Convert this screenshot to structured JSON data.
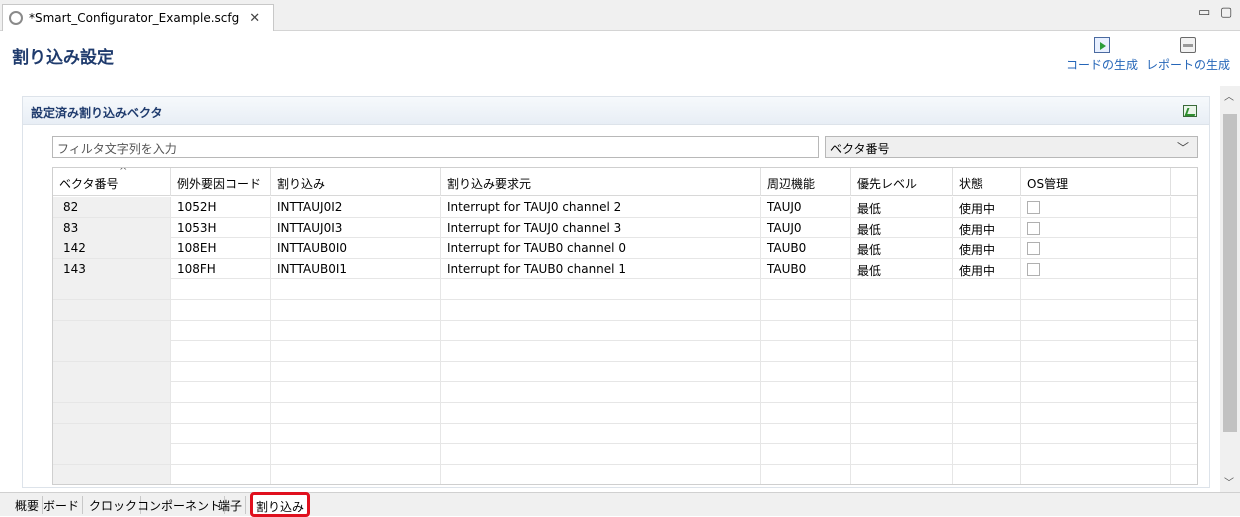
{
  "editor_tab": {
    "title": "*Smart_Configurator_Example.scfg",
    "close": "✕"
  },
  "window_controls": {
    "minimize": "▭",
    "maximize": "▢"
  },
  "header": {
    "title": "割り込み設定",
    "actions": {
      "generate_code": "コードの生成",
      "generate_report": "レポートの生成"
    }
  },
  "section": {
    "title": "設定済み割り込みベクタ",
    "filter_placeholder": "フィルタ文字列を入力",
    "combo_value": "ベクタ番号"
  },
  "table": {
    "columns": [
      "ベクタ番号",
      "例外要因コード",
      "割り込み",
      "割り込み要求元",
      "周辺機能",
      "優先レベル",
      "状態",
      "OS管理"
    ],
    "rows": [
      [
        "82",
        "1052H",
        "INTTAUJ0I2",
        "Interrupt for TAUJ0 channel 2",
        "TAUJ0",
        "最低",
        "使用中"
      ],
      [
        "83",
        "1053H",
        "INTTAUJ0I3",
        "Interrupt for TAUJ0 channel 3",
        "TAUJ0",
        "最低",
        "使用中"
      ],
      [
        "142",
        "108EH",
        "INTTAUB0I0",
        "Interrupt for TAUB0 channel 0",
        "TAUB0",
        "最低",
        "使用中"
      ],
      [
        "143",
        "108FH",
        "INTTAUB0I1",
        "Interrupt for TAUB0 channel 1",
        "TAUB0",
        "最低",
        "使用中"
      ]
    ]
  },
  "bottom_tabs": [
    "概要",
    "ボード",
    "クロック",
    "コンポーネント",
    "端子",
    "割り込み"
  ],
  "active_bottom_tab": "割り込み",
  "colors": {
    "accent": "#1f3b6d",
    "link": "#2566b8",
    "highlight": "#e0101e"
  }
}
